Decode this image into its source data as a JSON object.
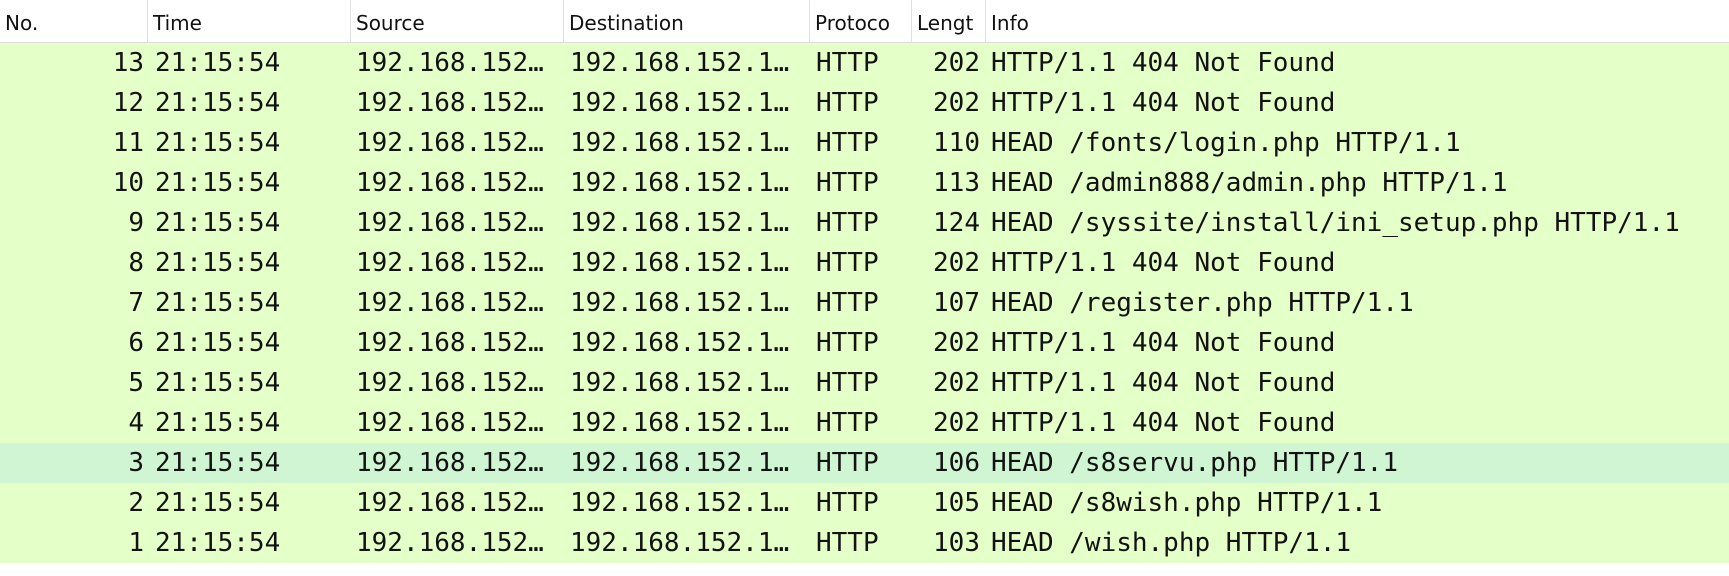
{
  "columns": {
    "no": "No.",
    "time": "Time",
    "source": "Source",
    "destination": "Destination",
    "protocol": "Protoco",
    "length": "Lengt",
    "info": "Info"
  },
  "sort_icon": "chevron-down-icon",
  "selected_row": "3",
  "packets": [
    {
      "no": "13",
      "time": "21:15:54",
      "source": "192.168.152…",
      "destination": "192.168.152.1…",
      "protocol": "HTTP",
      "length": "202",
      "info": "HTTP/1.1 404 Not Found"
    },
    {
      "no": "12",
      "time": "21:15:54",
      "source": "192.168.152…",
      "destination": "192.168.152.1…",
      "protocol": "HTTP",
      "length": "202",
      "info": "HTTP/1.1 404 Not Found"
    },
    {
      "no": "11",
      "time": "21:15:54",
      "source": "192.168.152…",
      "destination": "192.168.152.1…",
      "protocol": "HTTP",
      "length": "110",
      "info": "HEAD /fonts/login.php HTTP/1.1"
    },
    {
      "no": "10",
      "time": "21:15:54",
      "source": "192.168.152…",
      "destination": "192.168.152.1…",
      "protocol": "HTTP",
      "length": "113",
      "info": "HEAD /admin888/admin.php HTTP/1.1"
    },
    {
      "no": "9",
      "time": "21:15:54",
      "source": "192.168.152…",
      "destination": "192.168.152.1…",
      "protocol": "HTTP",
      "length": "124",
      "info": "HEAD /syssite/install/ini_setup.php HTTP/1.1"
    },
    {
      "no": "8",
      "time": "21:15:54",
      "source": "192.168.152…",
      "destination": "192.168.152.1…",
      "protocol": "HTTP",
      "length": "202",
      "info": "HTTP/1.1 404 Not Found"
    },
    {
      "no": "7",
      "time": "21:15:54",
      "source": "192.168.152…",
      "destination": "192.168.152.1…",
      "protocol": "HTTP",
      "length": "107",
      "info": "HEAD /register.php HTTP/1.1"
    },
    {
      "no": "6",
      "time": "21:15:54",
      "source": "192.168.152…",
      "destination": "192.168.152.1…",
      "protocol": "HTTP",
      "length": "202",
      "info": "HTTP/1.1 404 Not Found"
    },
    {
      "no": "5",
      "time": "21:15:54",
      "source": "192.168.152…",
      "destination": "192.168.152.1…",
      "protocol": "HTTP",
      "length": "202",
      "info": "HTTP/1.1 404 Not Found"
    },
    {
      "no": "4",
      "time": "21:15:54",
      "source": "192.168.152…",
      "destination": "192.168.152.1…",
      "protocol": "HTTP",
      "length": "202",
      "info": "HTTP/1.1 404 Not Found"
    },
    {
      "no": "3",
      "time": "21:15:54",
      "source": "192.168.152…",
      "destination": "192.168.152.1…",
      "protocol": "HTTP",
      "length": "106",
      "info": "HEAD /s8servu.php HTTP/1.1"
    },
    {
      "no": "2",
      "time": "21:15:54",
      "source": "192.168.152…",
      "destination": "192.168.152.1…",
      "protocol": "HTTP",
      "length": "105",
      "info": "HEAD /s8wish.php HTTP/1.1"
    },
    {
      "no": "1",
      "time": "21:15:54",
      "source": "192.168.152…",
      "destination": "192.168.152.1…",
      "protocol": "HTTP",
      "length": "103",
      "info": "HEAD /wish.php HTTP/1.1"
    }
  ]
}
